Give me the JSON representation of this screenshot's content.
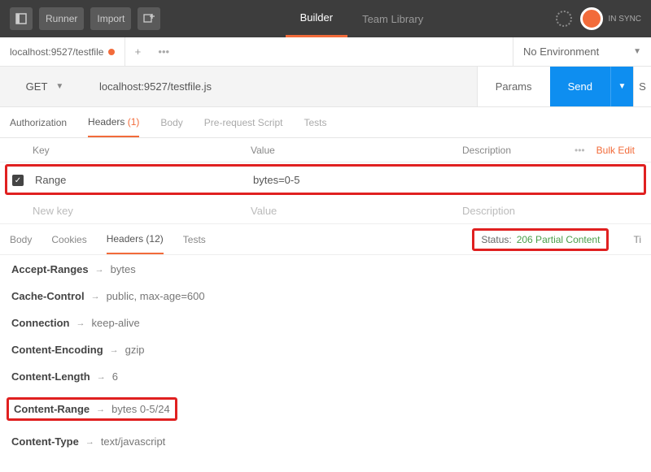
{
  "top": {
    "runner": "Runner",
    "import": "Import",
    "builder": "Builder",
    "teamLibrary": "Team Library",
    "sync": "IN SYNC"
  },
  "reqTab": {
    "label": "localhost:9527/testfile"
  },
  "env": {
    "label": "No Environment"
  },
  "request": {
    "method": "GET",
    "url": "localhost:9527/testfile.js",
    "paramsLabel": "Params",
    "sendLabel": "Send",
    "saveStub": "S"
  },
  "reqTabs": {
    "authorization": "Authorization",
    "headers": "Headers",
    "headersCount": "(1)",
    "body": "Body",
    "preRequest": "Pre-request Script",
    "tests": "Tests"
  },
  "headerTable": {
    "keyHead": "Key",
    "valueHead": "Value",
    "descHead": "Description",
    "bulkEdit": "Bulk Edit",
    "dots": "•••",
    "row": {
      "key": "Range",
      "value": "bytes=0-5"
    },
    "ph": {
      "key": "New key",
      "value": "Value",
      "desc": "Description"
    }
  },
  "respTabs": {
    "body": "Body",
    "cookies": "Cookies",
    "headers": "Headers",
    "headersCount": "(12)",
    "tests": "Tests",
    "statusLabel": "Status:",
    "statusCode": "206 Partial Content",
    "timeStub": "Ti"
  },
  "respHeaders": [
    {
      "name": "Accept-Ranges",
      "value": "bytes"
    },
    {
      "name": "Cache-Control",
      "value": "public, max-age=600"
    },
    {
      "name": "Connection",
      "value": "keep-alive"
    },
    {
      "name": "Content-Encoding",
      "value": "gzip"
    },
    {
      "name": "Content-Length",
      "value": "6"
    },
    {
      "name": "Content-Range",
      "value": "bytes 0-5/24",
      "highlight": true
    },
    {
      "name": "Content-Type",
      "value": "text/javascript"
    }
  ]
}
